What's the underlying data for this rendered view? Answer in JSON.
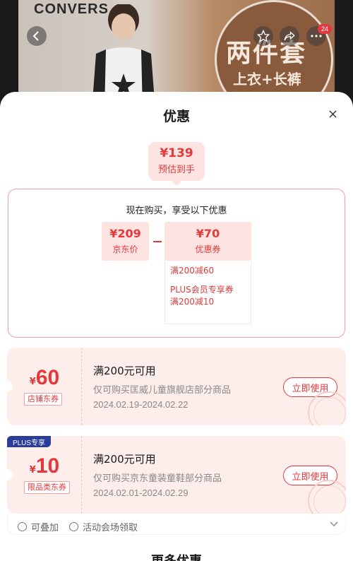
{
  "banner": {
    "brand": "CONVERS",
    "promo_title": "两件套",
    "promo_subtitle": "上衣+长裤",
    "cart_badge": "24"
  },
  "sheet": {
    "title": "优惠"
  },
  "final_price": {
    "amount": "¥139",
    "label": "预估到手"
  },
  "breakdown": {
    "caption": "现在购买，享受以下优惠",
    "jd_price": {
      "amount": "¥209",
      "label": "京东价"
    },
    "discount": {
      "amount": "¥70",
      "label": "优惠券"
    },
    "coupon_details": [
      "满200减60",
      "PLUS会员专享券",
      "满200减10"
    ]
  },
  "coupons": [
    {
      "currency": "¥",
      "amount": "60",
      "tag": "店铺东券",
      "condition": "满200元可用",
      "scope": "仅可购买匡威儿童旗舰店部分商品",
      "date": "2024.02.19-2024.02.22",
      "action": "立即使用"
    },
    {
      "badge": "PLUS专享",
      "currency": "¥",
      "amount": "10",
      "tag": "限品类东券",
      "condition": "满200元可用",
      "scope": "仅可购买京东童装童鞋部分商品",
      "date": "2024.02.01-2024.02.29",
      "action": "立即使用"
    }
  ],
  "info_row": {
    "stackable": "可叠加",
    "venue": "活动会场领取"
  },
  "more": {
    "title": "更多优惠"
  },
  "colors": {
    "accent": "#e4393c",
    "accent_light": "#fde4e1",
    "card_bg": "#fdeeec",
    "plus_badge": "#2a3d9b"
  }
}
